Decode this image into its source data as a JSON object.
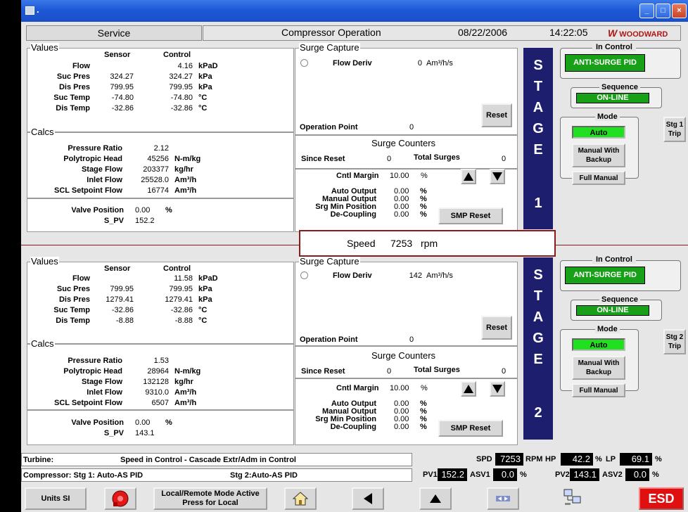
{
  "header": {
    "service": "Service",
    "title": "Compressor Operation",
    "date": "08/22/2006",
    "time": "14:22:05",
    "brand": "WOODWARD",
    "title_dot": "."
  },
  "s1": {
    "values_label": "Values",
    "sensor_label": "Sensor",
    "control_label": "Control",
    "rows": [
      {
        "name": "Flow",
        "sensor": "",
        "control": "4.16",
        "unit": "kPaD"
      },
      {
        "name": "Suc Pres",
        "sensor": "324.27",
        "control": "324.27",
        "unit": "kPa"
      },
      {
        "name": "Dis Pres",
        "sensor": "799.95",
        "control": "799.95",
        "unit": "kPa"
      },
      {
        "name": "Suc Temp",
        "sensor": "-74.80",
        "control": "-74.80",
        "unit": "°C"
      },
      {
        "name": "Dis Temp",
        "sensor": "-32.86",
        "control": "-32.86",
        "unit": "°C"
      }
    ],
    "calcs_label": "Calcs",
    "calcs": [
      {
        "name": "Pressure Ratio",
        "value": "2.12",
        "unit": ""
      },
      {
        "name": "Polytropic Head",
        "value": "45256",
        "unit": "N-m/kg"
      },
      {
        "name": "Stage Flow",
        "value": "203377",
        "unit": "kg/hr"
      },
      {
        "name": "Inlet Flow",
        "value": "25528.0",
        "unit": "Am³/h"
      },
      {
        "name": "SCL Setpoint Flow",
        "value": "16774",
        "unit": "Am³/h"
      }
    ],
    "valve_label": "Valve Position",
    "valve_value": "0.00",
    "valve_unit": "%",
    "spv_label": "S_PV",
    "spv_value": "152.2",
    "surge_label": "Surge Capture",
    "flow_deriv_label": "Flow Deriv",
    "flow_deriv_value": "0",
    "flow_deriv_unit": "Am³/h/s",
    "reset_label": "Reset",
    "op_point_label": "Operation Point",
    "op_point_value": "0",
    "counters_label": "Surge Counters",
    "since_reset_label": "Since Reset",
    "since_reset_value": "0",
    "total_label": "Total Surges",
    "total_value": "0",
    "cntl_margin_label": "Cntl Margin",
    "cntl_margin_value": "10.00",
    "cntl_margin_unit": "%",
    "outputs": [
      {
        "name": "Auto Output",
        "value": "0.00",
        "unit": "%"
      },
      {
        "name": "Manual Output",
        "value": "0.00",
        "unit": "%"
      },
      {
        "name": "Srg Min Position",
        "value": "0.00",
        "unit": "%"
      },
      {
        "name": "De-Coupling",
        "value": "0.00",
        "unit": "%"
      }
    ],
    "smp_reset": "SMP Reset",
    "stage_letters": [
      "S",
      "T",
      "A",
      "G",
      "E"
    ],
    "stage_num": "1",
    "in_control_label": "In Control",
    "in_control_value": "ANTI-SURGE PID",
    "sequence_label": "Sequence",
    "sequence_value": "ON-LINE",
    "mode_label": "Mode",
    "auto": "Auto",
    "manual_backup": "Manual With Backup",
    "full_manual": "Full Manual",
    "trip": "Stg 1 Trip"
  },
  "speed": {
    "label": "Speed",
    "value": "7253",
    "unit": "rpm"
  },
  "s2": {
    "values_label": "Values",
    "sensor_label": "Sensor",
    "control_label": "Control",
    "rows": [
      {
        "name": "Flow",
        "sensor": "",
        "control": "11.58",
        "unit": "kPaD"
      },
      {
        "name": "Suc Pres",
        "sensor": "799.95",
        "control": "799.95",
        "unit": "kPa"
      },
      {
        "name": "Dis Pres",
        "sensor": "1279.41",
        "control": "1279.41",
        "unit": "kPa"
      },
      {
        "name": "Suc Temp",
        "sensor": "-32.86",
        "control": "-32.86",
        "unit": "°C"
      },
      {
        "name": "Dis Temp",
        "sensor": "-8.88",
        "control": "-8.88",
        "unit": "°C"
      }
    ],
    "calcs_label": "Calcs",
    "calcs": [
      {
        "name": "Pressure Ratio",
        "value": "1.53",
        "unit": ""
      },
      {
        "name": "Polytropic Head",
        "value": "28964",
        "unit": "N-m/kg"
      },
      {
        "name": "Stage Flow",
        "value": "132128",
        "unit": "kg/hr"
      },
      {
        "name": "Inlet Flow",
        "value": "9310.0",
        "unit": "Am³/h"
      },
      {
        "name": "SCL Setpoint Flow",
        "value": "6507",
        "unit": "Am³/h"
      }
    ],
    "valve_label": "Valve Position",
    "valve_value": "0.00",
    "valve_unit": "%",
    "spv_label": "S_PV",
    "spv_value": "143.1",
    "surge_label": "Surge Capture",
    "flow_deriv_label": "Flow Deriv",
    "flow_deriv_value": "142",
    "flow_deriv_unit": "Am³/h/s",
    "reset_label": "Reset",
    "op_point_label": "Operation Point",
    "op_point_value": "0",
    "counters_label": "Surge Counters",
    "since_reset_label": "Since Reset",
    "since_reset_value": "0",
    "total_label": "Total Surges",
    "total_value": "0",
    "cntl_margin_label": "Cntl Margin",
    "cntl_margin_value": "10.00",
    "cntl_margin_unit": "%",
    "outputs": [
      {
        "name": "Auto Output",
        "value": "0.00",
        "unit": "%"
      },
      {
        "name": "Manual Output",
        "value": "0.00",
        "unit": "%"
      },
      {
        "name": "Srg Min Position",
        "value": "0.00",
        "unit": "%"
      },
      {
        "name": "De-Coupling",
        "value": "0.00",
        "unit": "%"
      }
    ],
    "smp_reset": "SMP Reset",
    "stage_letters": [
      "S",
      "T",
      "A",
      "G",
      "E"
    ],
    "stage_num": "2",
    "in_control_label": "In Control",
    "in_control_value": "ANTI-SURGE PID",
    "sequence_label": "Sequence",
    "sequence_value": "ON-LINE",
    "mode_label": "Mode",
    "auto": "Auto",
    "manual_backup": "Manual With Backup",
    "full_manual": "Full Manual",
    "trip": "Stg 2 Trip"
  },
  "status": {
    "turbine_label": "Turbine:",
    "turbine_text": "Speed in Control - Cascade Extr/Adm in Control",
    "compressor_text": "Compressor: Stg 1: Auto-AS PID",
    "stg2_text": "Stg 2:Auto-AS PID",
    "spd_label": "SPD",
    "spd_value": "7253",
    "rpm_label": "RPM",
    "hp_label": "HP",
    "hp_value": "42.2",
    "pct1": "%",
    "lp_label": "LP",
    "lp_value": "69.1",
    "pct2": "%",
    "pv1_label": "PV1",
    "pv1_value": "152.2",
    "asv1_label": "ASV1",
    "asv1_value": "0.0",
    "pct3": "%",
    "pv2_label": "PV2",
    "pv2_value": "143.1",
    "asv2_label": "ASV2",
    "asv2_value": "0.0",
    "pct4": "%"
  },
  "toolbar": {
    "units": "Units SI",
    "local_remote": "Local/Remote Mode Active Press for Local",
    "esd": "ESD"
  },
  "colors": {
    "title_blue": "#1e58d8",
    "stage_navy": "#1e1e6e",
    "green": "#18a018",
    "esd_red": "#e01010",
    "separator": "#8c1a1a"
  }
}
